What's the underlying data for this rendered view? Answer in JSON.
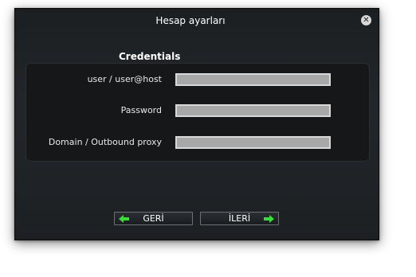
{
  "window": {
    "title": "Hesap ayarları",
    "close_icon": "close-icon"
  },
  "section": {
    "title": "Credentials"
  },
  "fields": {
    "user_label": "user / user@host",
    "user_value": "",
    "password_label": "Password",
    "password_value": "",
    "domain_label": "Domain / Outbound proxy",
    "domain_value": ""
  },
  "buttons": {
    "back_label": "GERİ",
    "next_label": "İLERİ",
    "back_icon": "arrow-left-icon",
    "next_icon": "arrow-right-icon"
  },
  "colors": {
    "arrow": "#3ddc3d",
    "dialog_bg": "#1f2225",
    "input_bg": "#a8a8a8"
  }
}
